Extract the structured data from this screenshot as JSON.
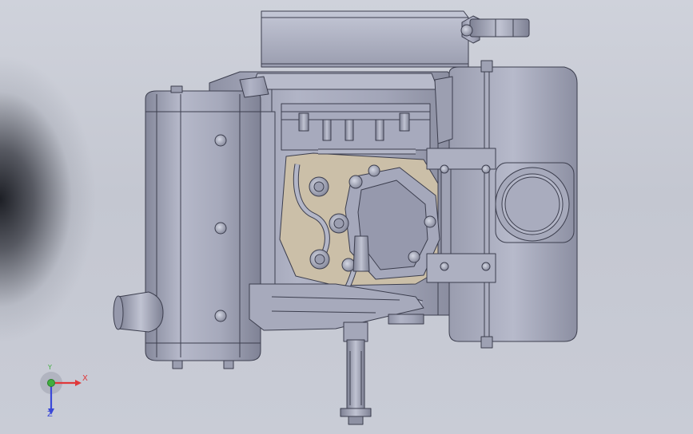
{
  "viewport": {
    "background_color": "#c6c9d3",
    "model_outline_color": "#3c3e4e",
    "model_fill_color": "#a3a6b8",
    "model_highlight_color": "#c3c6d6",
    "cutaway_fill_color": "#cbbfa8"
  },
  "triad": {
    "x_label": "X",
    "y_label": "Y",
    "z_label": "Z",
    "x_color": "#e0383a",
    "y_color": "#3fae3f",
    "z_color": "#3a48d8"
  }
}
